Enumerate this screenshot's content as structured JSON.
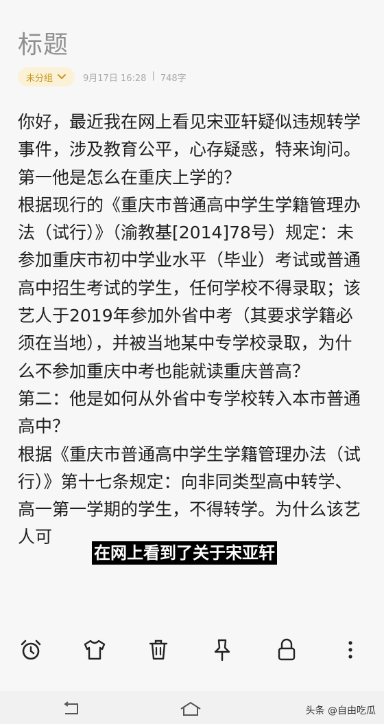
{
  "note": {
    "title": "标题",
    "group": "未分组",
    "date": "9月17日 16:28",
    "separator": "|",
    "word_count": "748字"
  },
  "content": {
    "paragraphs": [
      "你好，最近我在网上看见宋亚轩疑似违规转学事件，涉及教育公平，心存疑惑，特来询问。第一他是怎么在重庆上学的？",
      "根据现行的《重庆市普通高中学生学籍管理办法（试行）》（渝教基[2014]78号）规定：未参加重庆市初中学业水平（毕业）考试或普通高中招生考试的学生，任何学校不得录取；该艺人于2019年参加外省中考（其要求学籍必须在当地），并被当地某中专学校录取，为什么不参加重庆中考也能就读重庆普高？",
      "第二：他是如何从外省中专学校转入本市普通高中？",
      "根据《重庆市普通高中学生学籍管理办法（试行）》第十七条规定：向非同类型高中转学、高一第一学期的学生，不得转学。为什么该艺人可"
    ]
  },
  "caption": "在网上看到了关于宋亚轩",
  "toolbar": {
    "icons": [
      "alarm-clock-icon",
      "shirt-icon",
      "trash-icon",
      "pin-icon",
      "lock-icon",
      "more-icon"
    ]
  },
  "watermark": "头条 @自由吃瓜",
  "colors": {
    "background": "#f7f7f7",
    "chip_bg": "#fbf1d6",
    "chip_text": "#c8961e",
    "title": "#8f8f8f"
  }
}
